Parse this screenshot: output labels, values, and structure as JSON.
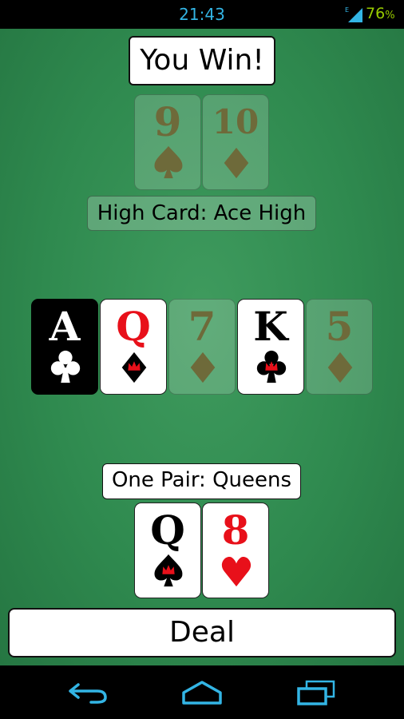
{
  "status_bar": {
    "time": "21:43",
    "network": "E",
    "battery": "76",
    "battery_unit": "%"
  },
  "result": {
    "text": "You Win!"
  },
  "opponent": {
    "hand_label": "High Card: Ace High",
    "cards": [
      {
        "rank": "9",
        "suit": "spades",
        "state": "faded"
      },
      {
        "rank": "10",
        "suit": "diamonds",
        "state": "faded"
      }
    ]
  },
  "board": {
    "cards": [
      {
        "rank": "A",
        "suit": "clubs",
        "state": "highlight"
      },
      {
        "rank": "Q",
        "suit": "diamonds",
        "state": "normal"
      },
      {
        "rank": "7",
        "suit": "diamonds",
        "state": "faded"
      },
      {
        "rank": "K",
        "suit": "clubs",
        "state": "normal"
      },
      {
        "rank": "5",
        "suit": "diamonds",
        "state": "faded"
      }
    ]
  },
  "player": {
    "hand_label": "One Pair: Queens",
    "cards": [
      {
        "rank": "Q",
        "suit": "spades",
        "state": "normal"
      },
      {
        "rank": "8",
        "suit": "hearts",
        "state": "normal"
      }
    ]
  },
  "deal_button": {
    "label": "Deal"
  },
  "nav": {
    "back": "back-icon",
    "home": "home-icon",
    "recents": "recents-icon"
  },
  "colors": {
    "felt": "#2f8a4f",
    "red": "#e8101a",
    "black": "#000000",
    "faded_ink": "#6e6a3a",
    "status_blue": "#33b5e5",
    "battery_green": "#99cc00"
  }
}
